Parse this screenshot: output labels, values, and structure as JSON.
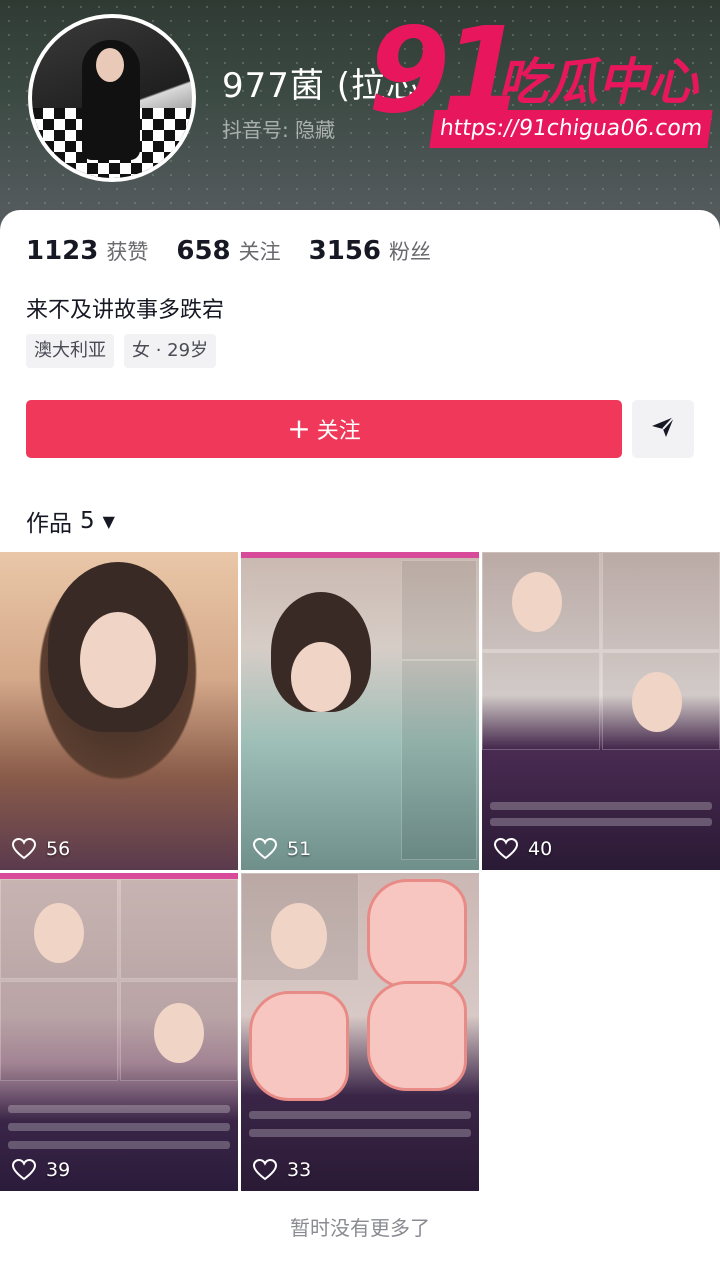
{
  "profile": {
    "username": "977菌 (拉芯)",
    "subline": "抖音号: 隐藏",
    "bio": "来不及讲故事多跌宕",
    "tags": [
      "澳大利亚",
      "女 · 29岁"
    ],
    "stats": [
      {
        "value": "1123",
        "label": "获赞"
      },
      {
        "value": "658",
        "label": "关注"
      },
      {
        "value": "3156",
        "label": "粉丝"
      }
    ]
  },
  "watermark": {
    "number": "91",
    "title": "吃瓜中心",
    "url": "https://91chigua06.com"
  },
  "actions": {
    "follow_label": "关注",
    "follow_plus": "+",
    "share_icon": "send-icon"
  },
  "works": {
    "label": "作品",
    "count": "5",
    "items": [
      {
        "likes": "56"
      },
      {
        "likes": "51"
      },
      {
        "likes": "40"
      },
      {
        "likes": "39"
      },
      {
        "likes": "33"
      }
    ]
  },
  "footer": {
    "end_text": "暂时没有更多了"
  },
  "colors": {
    "accent": "#f0395a",
    "watermark": "#e8175d"
  }
}
